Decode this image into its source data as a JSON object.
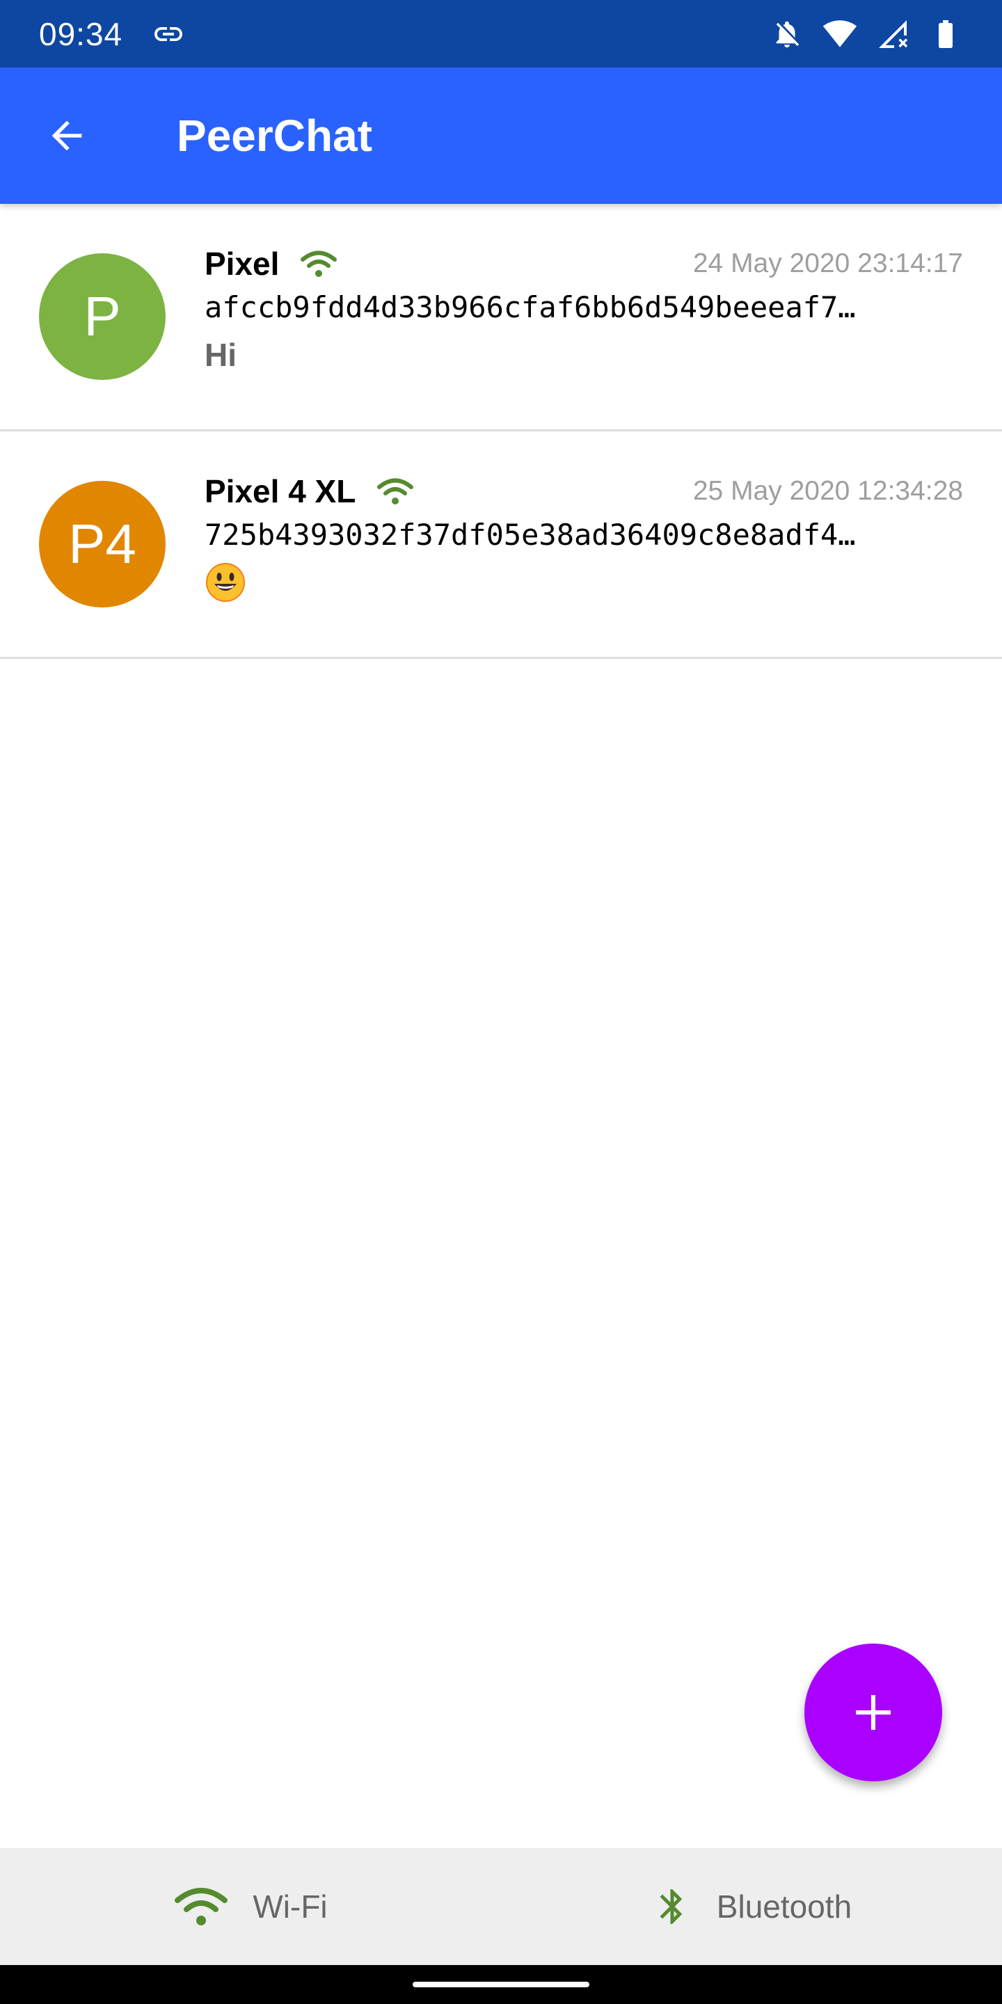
{
  "status_bar": {
    "time": "09:34",
    "icons": [
      "link-icon",
      "notifications-off-icon",
      "wifi-icon",
      "cellular-no-data-icon",
      "battery-icon"
    ]
  },
  "app_bar": {
    "title": "PeerChat",
    "back_icon": "arrow-back-icon"
  },
  "chats": [
    {
      "avatar_text": "P",
      "avatar_color": "#7cb342",
      "name": "Pixel",
      "connection_icon": "wifi-icon",
      "timestamp": "24 May 2020 23:14:17",
      "peer_id": "afccb9fdd4d33b966cfaf6bb6d549beeeaf7…",
      "last_message": "Hi"
    },
    {
      "avatar_text": "P4",
      "avatar_color": "#e08600",
      "name": "Pixel 4 XL",
      "connection_icon": "wifi-icon",
      "timestamp": "25 May 2020 12:34:28",
      "peer_id": "725b4393032f37df05e38ad36409c8e8adf4…",
      "last_message": "😀"
    }
  ],
  "fab": {
    "icon": "plus-icon",
    "color": "#aa00ff"
  },
  "bottom_bar": {
    "items": [
      {
        "label": "Wi-Fi",
        "icon": "wifi-icon"
      },
      {
        "label": "Bluetooth",
        "icon": "bluetooth-icon"
      }
    ]
  },
  "colors": {
    "status_bar": "#0d47a1",
    "app_bar": "#2962ff",
    "connected_green": "#558b2f"
  }
}
